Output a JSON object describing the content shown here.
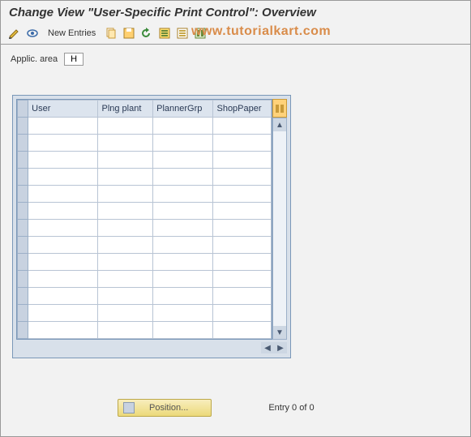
{
  "title": "Change View \"User-Specific Print Control\": Overview",
  "toolbar": {
    "new_entries": "New Entries"
  },
  "watermark": "www.tutorialkart.com",
  "filter": {
    "label": "Applic. area",
    "value": "H"
  },
  "table": {
    "headers": {
      "user": "User",
      "plant": "Plng plant",
      "grp": "PlannerGrp",
      "paper": "ShopPaper"
    },
    "rows": [
      {
        "user": "",
        "plant": "",
        "grp": "",
        "paper": ""
      },
      {
        "user": "",
        "plant": "",
        "grp": "",
        "paper": ""
      },
      {
        "user": "",
        "plant": "",
        "grp": "",
        "paper": ""
      },
      {
        "user": "",
        "plant": "",
        "grp": "",
        "paper": ""
      },
      {
        "user": "",
        "plant": "",
        "grp": "",
        "paper": ""
      },
      {
        "user": "",
        "plant": "",
        "grp": "",
        "paper": ""
      },
      {
        "user": "",
        "plant": "",
        "grp": "",
        "paper": ""
      },
      {
        "user": "",
        "plant": "",
        "grp": "",
        "paper": ""
      },
      {
        "user": "",
        "plant": "",
        "grp": "",
        "paper": ""
      },
      {
        "user": "",
        "plant": "",
        "grp": "",
        "paper": ""
      },
      {
        "user": "",
        "plant": "",
        "grp": "",
        "paper": ""
      },
      {
        "user": "",
        "plant": "",
        "grp": "",
        "paper": ""
      },
      {
        "user": "",
        "plant": "",
        "grp": "",
        "paper": ""
      }
    ]
  },
  "footer": {
    "position_label": "Position...",
    "entry_text": "Entry 0 of 0"
  },
  "icons": {
    "change": "change-display-icon",
    "other": "other-view-icon",
    "copy": "copy-icon",
    "save": "save-icon",
    "undo": "undo-icon",
    "select_all": "select-all-icon",
    "deselect": "deselect-icon",
    "config": "configure-icon"
  }
}
